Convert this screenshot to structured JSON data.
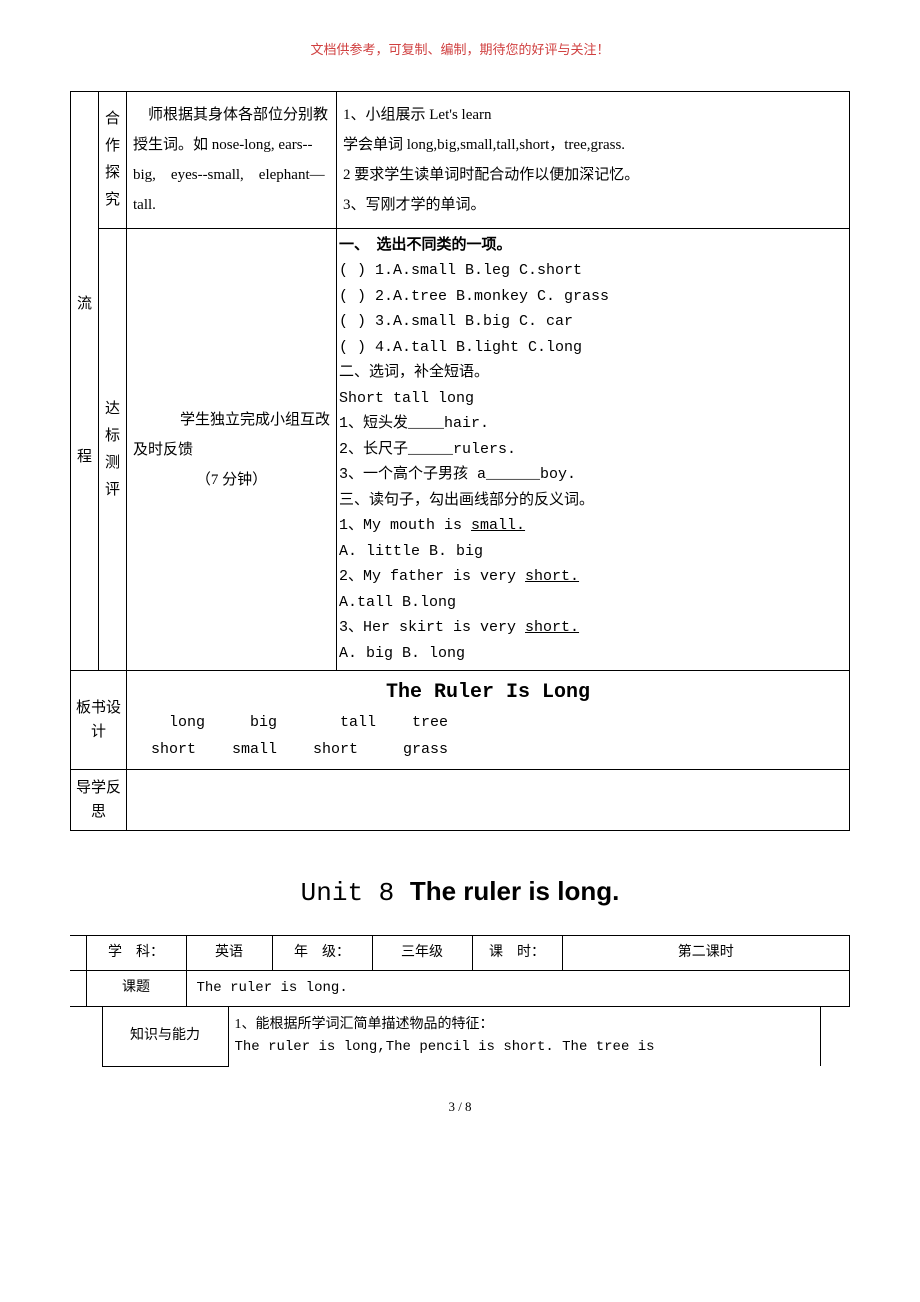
{
  "header_note": "文档供参考，可复制、编制，期待您的好评与关注！",
  "process": {
    "row_label_top": "流",
    "row_label_bottom": "程",
    "coop": {
      "label": "合作探究",
      "teacher": "　师根据其身体各部位分别教授生词。如 nose-long, ears--big,　eyes--small,　elephant—tall.",
      "student_1": "1、小组展示 Let's learn",
      "student_2": "学会单词 long,big,small,tall,short，tree,grass.",
      "student_3": "2 要求学生读单词时配合动作以便加深记忆。",
      "student_4": "3、写刚才学的单词。"
    },
    "test": {
      "label": "达标测评",
      "teacher_l1": "学生独立完成小组互改",
      "teacher_l2": "及时反馈",
      "teacher_l3": "（7 分钟）",
      "ex1_title": "一、　选出不同类的一项。",
      "ex1_1": "(  ) 1.A.small B.leg C.short",
      "ex1_2": "(  ) 2.A.tree B.monkey C. grass",
      "ex1_3": "(  ) 3.A.small B.big  C. car",
      "ex1_4": " (  ) 4.A.tall B.light  C.long",
      "ex2_title": "二、选词，补全短语。",
      "ex2_words": "Short  tall  long",
      "ex2_1": "1、短头发____hair.",
      "ex2_2": "2、长尺子_____rulers.",
      "ex2_3": "3、一个高个子男孩 a______boy.",
      "ex3_title": "三、读句子，勾出画线部分的反义词。",
      "ex3_1a": "1、My mouth is ",
      "ex3_1b": "small.",
      "ex3_1opt": "A.  little    B. big",
      "ex3_2a": "2、My father is very ",
      "ex3_2b": "short.",
      "ex3_2opt": "A.tall    B.long",
      "ex3_3a": "3、Her skirt is very ",
      "ex3_3b": "short.",
      "ex3_3opt": "A. big   B.  long"
    },
    "board": {
      "label": "板书设计",
      "title": "The Ruler Is Long",
      "line1": "  long     big       tall    tree",
      "line2": "short    small    short     grass"
    },
    "reflect": {
      "label": "导学反思"
    }
  },
  "unit": {
    "prefix": "Unit 8 ",
    "title": "The ruler is long."
  },
  "meta": {
    "subject_lbl": "学　科：",
    "subject_val": "英语",
    "grade_lbl": "年　级：",
    "grade_val": "三年级",
    "period_lbl": "课　时：",
    "period_val": "第二课时",
    "topic_lbl": "课题",
    "topic_val": "The ruler is long."
  },
  "obj": {
    "label": "知识与能力",
    "line1": "1、能根据所学词汇简单描述物品的特征：",
    "line2": "The ruler is long,The pencil is short. The tree is"
  },
  "footer": "3 / 8"
}
